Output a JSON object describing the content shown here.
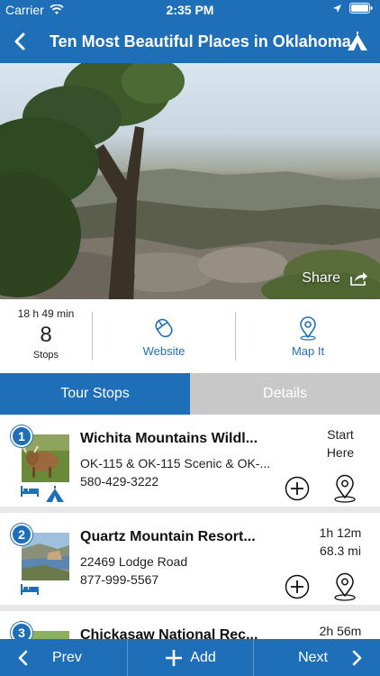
{
  "status": {
    "carrier": "Carrier",
    "time": "2:35 PM"
  },
  "nav": {
    "title": "Ten Most Beautiful Places in Oklahoma"
  },
  "hero": {
    "share_label": "Share"
  },
  "summary": {
    "duration": "18 h 49 min",
    "stops_count": "8",
    "stops_label": "Stops",
    "website_label": "Website",
    "mapit_label": "Map It"
  },
  "tabs": {
    "tour_stops": "Tour Stops",
    "details": "Details"
  },
  "stops": [
    {
      "number": "1",
      "name": "Wichita Mountains Wildl...",
      "address": "OK-115 & OK-115 Scenic & OK-...",
      "phone": "580-429-3222",
      "time_line1": "Start",
      "time_line2": "Here",
      "amenities": [
        "bed-icon",
        "tent-icon"
      ]
    },
    {
      "number": "2",
      "name": "Quartz Mountain Resort...",
      "address": "22469 Lodge Road",
      "phone": "877-999-5567",
      "time_line1": "1h 12m",
      "time_line2": "68.3 mi",
      "amenities": [
        "bed-icon"
      ]
    },
    {
      "number": "3",
      "name": "Chickasaw National Rec...",
      "address": "",
      "phone": "",
      "time_line1": "2h 56m",
      "time_line2": "",
      "amenities": []
    }
  ],
  "bottom": {
    "prev": "Prev",
    "add": "Add",
    "next": "Next"
  },
  "colors": {
    "brand_blue": "#1f6fb8",
    "tab_inactive": "#c8c8c8"
  }
}
